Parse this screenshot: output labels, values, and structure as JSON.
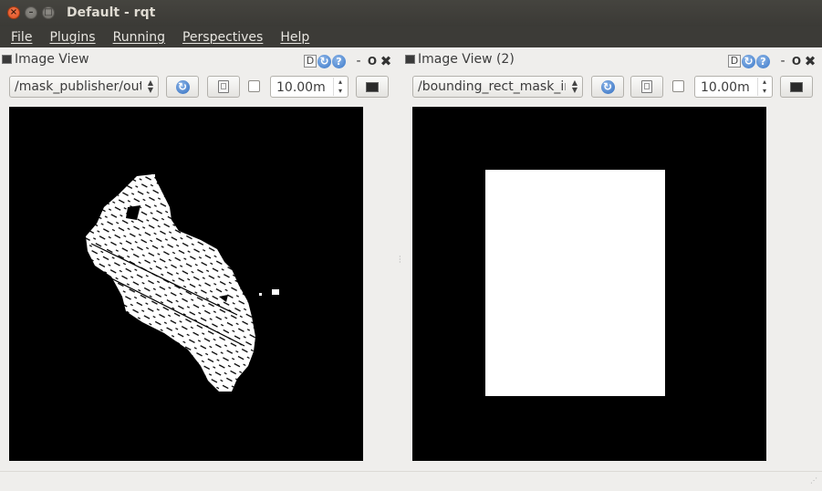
{
  "window": {
    "title": "Default - rqt",
    "close_glyph": "×",
    "min_glyph": "–",
    "max_glyph": "□"
  },
  "menu": [
    "File",
    "Plugins",
    "Running",
    "Perspectives",
    "Help"
  ],
  "dock_buttons": {
    "d": "D",
    "reload": "↻",
    "help": "?",
    "minimize": "-",
    "float": "O",
    "close": "✖"
  },
  "panels": [
    {
      "title": "Image View",
      "topic": "/mask_publisher/output",
      "refresh_glyph": "↻",
      "smooth_checked": false,
      "max_range": "10.00m"
    },
    {
      "title": "Image View (2)",
      "topic": "/bounding_rect_mask_image",
      "refresh_glyph": "↻",
      "smooth_checked": false,
      "max_range": "10.00m"
    }
  ],
  "colors": {
    "titlebar": "#3b3a36",
    "menubar": "#3c3b37",
    "canvas_bg": "#000000",
    "mask": "#ffffff",
    "close_button": "#e0501e"
  }
}
